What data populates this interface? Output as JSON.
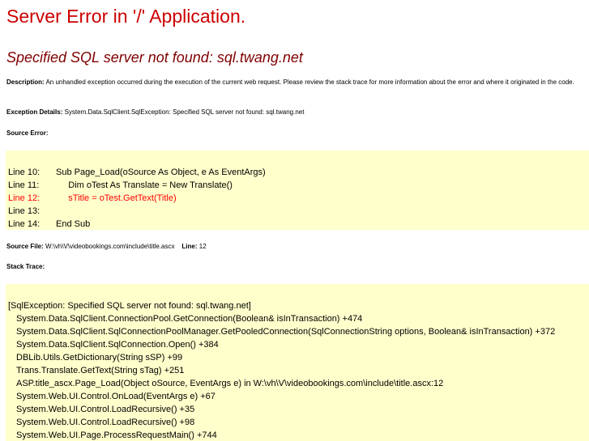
{
  "page": {
    "title": "Server Error in '/' Application.",
    "error_heading": "Specified SQL server not found: sql.twang.net",
    "description_label": "Description:",
    "description_text": " An unhandled exception occurred during the execution of the current web request. Please review the stack trace for more information about the error and where it originated in the code.",
    "exception_label": "Exception Details:",
    "exception_text": " System.Data.SqlClient.SqlException: Specified SQL server not found: sql.twang.net",
    "source_error_label": "Source Error:",
    "source_file_label": "Source File:",
    "source_file_value": " W:\\vh\\V\\videobookings.com\\include\\title.ascx",
    "line_label": "Line:",
    "line_value": " 12",
    "stack_trace_label": "Stack Trace:"
  },
  "source_lines": [
    {
      "num": "Line 10:",
      "code": "Sub Page_Load(oSource As Object, e As EventArgs)",
      "error": false
    },
    {
      "num": "Line 11:",
      "code": "     Dim oTest As Translate = New Translate()",
      "error": false
    },
    {
      "num": "Line 12:",
      "code": "     sTitle = oTest.GetText(Title)",
      "error": true
    },
    {
      "num": "Line 13:",
      "code": "",
      "error": false
    },
    {
      "num": "Line 14:",
      "code": "End Sub",
      "error": false
    }
  ],
  "stack_trace": [
    "[SqlException: Specified SQL server not found: sql.twang.net]",
    "System.Data.SqlClient.ConnectionPool.GetConnection(Boolean& isInTransaction) +474",
    "System.Data.SqlClient.SqlConnectionPoolManager.GetPooledConnection(SqlConnectionString options, Boolean& isInTransaction) +372",
    "System.Data.SqlClient.SqlConnection.Open() +384",
    "DBLib.Utils.GetDictionary(String sSP) +99",
    "Trans.Translate.GetText(String sTag) +251",
    "ASP.title_ascx.Page_Load(Object oSource, EventArgs e) in W:\\vh\\V\\videobookings.com\\include\\title.ascx:12",
    "System.Web.UI.Control.OnLoad(EventArgs e) +67",
    "System.Web.UI.Control.LoadRecursive() +35",
    "System.Web.UI.Control.LoadRecursive() +98",
    "System.Web.UI.Page.ProcessRequestMain() +744"
  ],
  "colors": {
    "title": "#cc0000",
    "heading": "#800000",
    "code_background": "#ffffcc",
    "error_line": "#ff0000"
  }
}
